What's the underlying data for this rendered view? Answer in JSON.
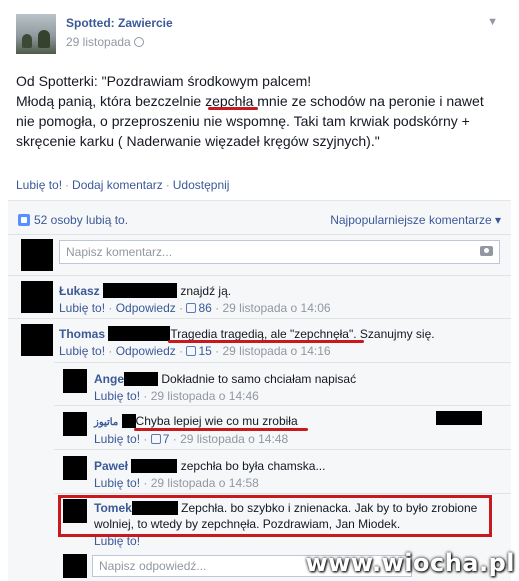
{
  "post": {
    "page_name": "Spotted: Zawiercie",
    "date": "29 listopada",
    "lines": [
      "Od Spotterki: \"Pozdrawiam środkowym palcem!",
      "Młodą panią, która bezczelnie zepchła mnie ze schodów na peronie i nawet",
      "nie pomogła, o przeproszeniu nie wspomnę. Taki tam krwiak podskórny +",
      "skręcenie karku ( Naderwanie więzadeł kręgów szyjnych).\""
    ]
  },
  "actions": {
    "like": "Lubię to!",
    "comment": "Dodaj komentarz",
    "share": "Udostępnij",
    "sep": "·"
  },
  "likes": {
    "text": "52 osoby lubią to.",
    "sort": "Najpopularniejsze komentarze ▾"
  },
  "new_comment": {
    "placeholder": "Napisz komentarz..."
  },
  "comments": [
    {
      "name": "Łukasz",
      "text": "znajdź ją.",
      "like": "Lubię to!",
      "reply": "Odpowiedz",
      "likes": "86",
      "time": "29 listopada o 14:06"
    },
    {
      "name": "Thomas",
      "text_highlight": "Tragedia tragedią, ale \"zepchnęła\"",
      "text_rest": ". Szanujmy się.",
      "like": "Lubię to!",
      "reply": "Odpowiedz",
      "likes": "15",
      "time": "29 listopada o 14:16"
    }
  ],
  "replies": [
    {
      "name": "Ange",
      "text": "Dokładnie to samo chciałam napisać",
      "like": "Lubię to!",
      "time": "29 listopada o 14:46"
    },
    {
      "name": "ماتيوز",
      "text": "Chyba lepiej wie co mu zrobiła",
      "like": "Lubię to!",
      "likes": "7",
      "time": "29 listopada o 14:48"
    },
    {
      "name": "Paweł",
      "text": "zepchła bo była chamska...",
      "like": "Lubię to!",
      "time": "29 listopada o 14:58"
    },
    {
      "name": "Tomek",
      "line1": "Zepchła. bo szybko i znienacka. Jak by to było zrobione",
      "line2": "wolniej, to wtedy by zepchnęła. Pozdrawiam, Jan Miodek.",
      "like": "Lubię to!"
    }
  ],
  "reply_input": {
    "placeholder": "Napisz odpowiedź..."
  },
  "watermark": "www.wiocha.pl",
  "colors": {
    "link": "#3b5998",
    "highlight": "#c8191e",
    "meta": "#9197a3"
  }
}
